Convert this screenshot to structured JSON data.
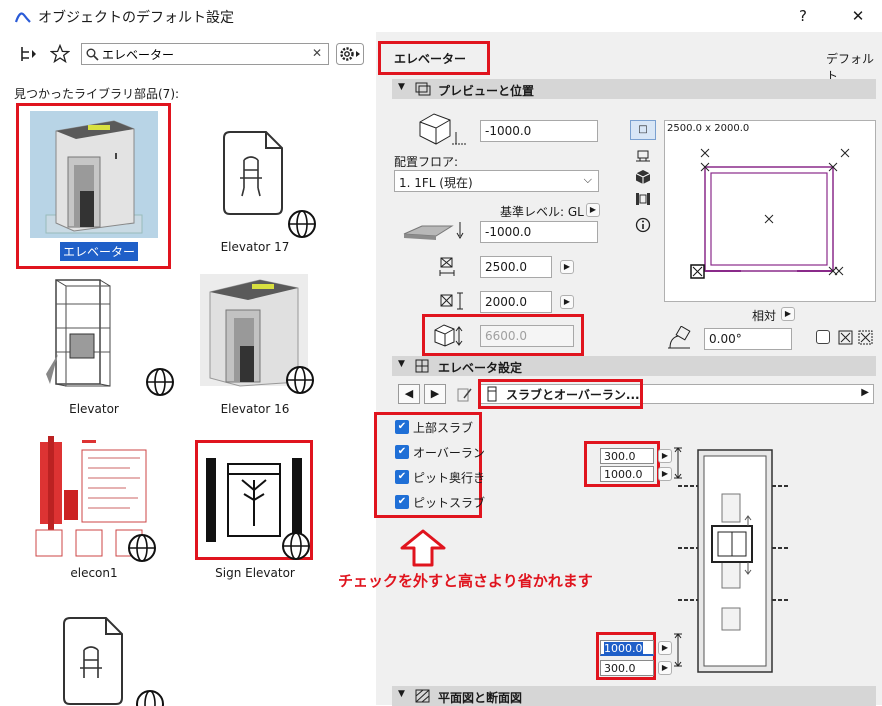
{
  "window": {
    "title": "オブジェクトのデフォルト設定",
    "help_label": "?",
    "close_label": "✕"
  },
  "library": {
    "search_value": "エレベーター",
    "search_clear": "✕",
    "found_label": "見つかったライブラリ部品(7):",
    "items": [
      {
        "label": "エレベーター"
      },
      {
        "label": "Elevator 17"
      },
      {
        "label": "Elevator"
      },
      {
        "label": "Elevator 16"
      },
      {
        "label": "elecon1"
      },
      {
        "label": "Sign Elevator"
      }
    ]
  },
  "panel": {
    "object_name": "エレベーター",
    "default_label": "デフォルト",
    "preview_section": "プレビューと位置",
    "offset_value": "-1000.0",
    "floor_label": "配置フロア:",
    "floor_value": "1. 1FL (現在)",
    "ref_level_label": "基準レベル: GL",
    "ref_value": "-1000.0",
    "width_value": "2500.0",
    "depth_value": "2000.0",
    "height_value": "6600.0",
    "preview_dims": "2500.0 x 2000.0",
    "relative_label": "相対",
    "angle_value": "0.00°",
    "elevator_section": "エレベータ設定",
    "tab_label": "スラブとオーバーラン...",
    "checks": [
      "上部スラブ",
      "オーバーラン",
      "ピット奥行き",
      "ピットスラブ"
    ],
    "top_values": [
      "300.0",
      "1000.0"
    ],
    "bottom_values": [
      "1000.0",
      "300.0"
    ],
    "note": "チェックを外すと高さより省かれます",
    "plan_section": "平面図と断面図"
  },
  "colors": {
    "accent": "#e0141e",
    "checkbox": "#1f6fd6",
    "preview_outline": "#8a2a8a"
  }
}
